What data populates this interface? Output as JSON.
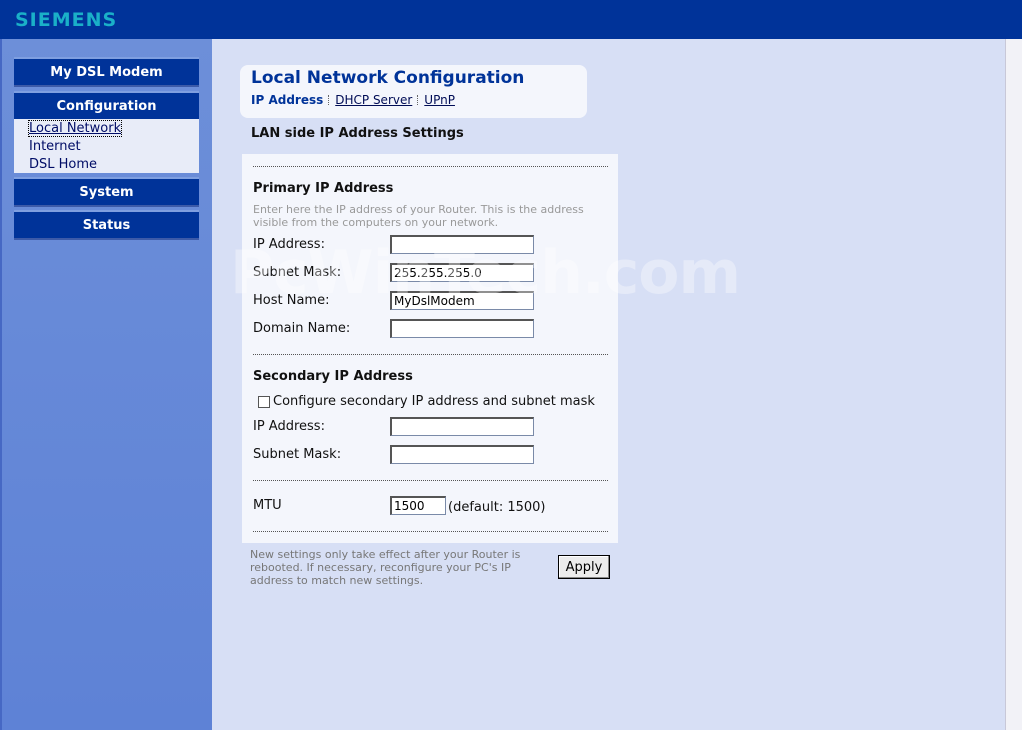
{
  "header": {
    "logo": "SIEMENS"
  },
  "sidebar": {
    "my_dsl_modem": "My DSL Modem",
    "configuration": "Configuration",
    "sub_items": [
      "Local Network",
      "Internet",
      "DSL Home"
    ],
    "system": "System",
    "status": "Status"
  },
  "page": {
    "title": "Local Network Configuration",
    "tabs": [
      "IP Address",
      "DHCP Server",
      "UPnP"
    ],
    "section_heading": "LAN side IP Address Settings"
  },
  "primary": {
    "heading": "Primary IP Address",
    "hint": "Enter here the IP address of your Router. This is the address visible from the computers on your network.",
    "ip_label": "IP Address:",
    "ip_value": "",
    "mask_label": "Subnet Mask:",
    "mask_value": "255.255.255.0",
    "host_label": "Host Name:",
    "host_value": "MyDslModem",
    "domain_label": "Domain Name:",
    "domain_value": ""
  },
  "secondary": {
    "heading": "Secondary IP Address",
    "checkbox_label": "Configure secondary IP address and subnet mask",
    "ip_label": "IP Address:",
    "ip_value": "",
    "mask_label": "Subnet Mask:",
    "mask_value": ""
  },
  "mtu": {
    "label": "MTU",
    "value": "1500",
    "default_text": "(default: 1500)"
  },
  "footer": {
    "note": "New settings only take effect after your Router is rebooted. If necessary, reconfigure your PC's IP address to match new settings.",
    "apply_label": "Apply"
  },
  "watermark": "PcWinTech.com"
}
